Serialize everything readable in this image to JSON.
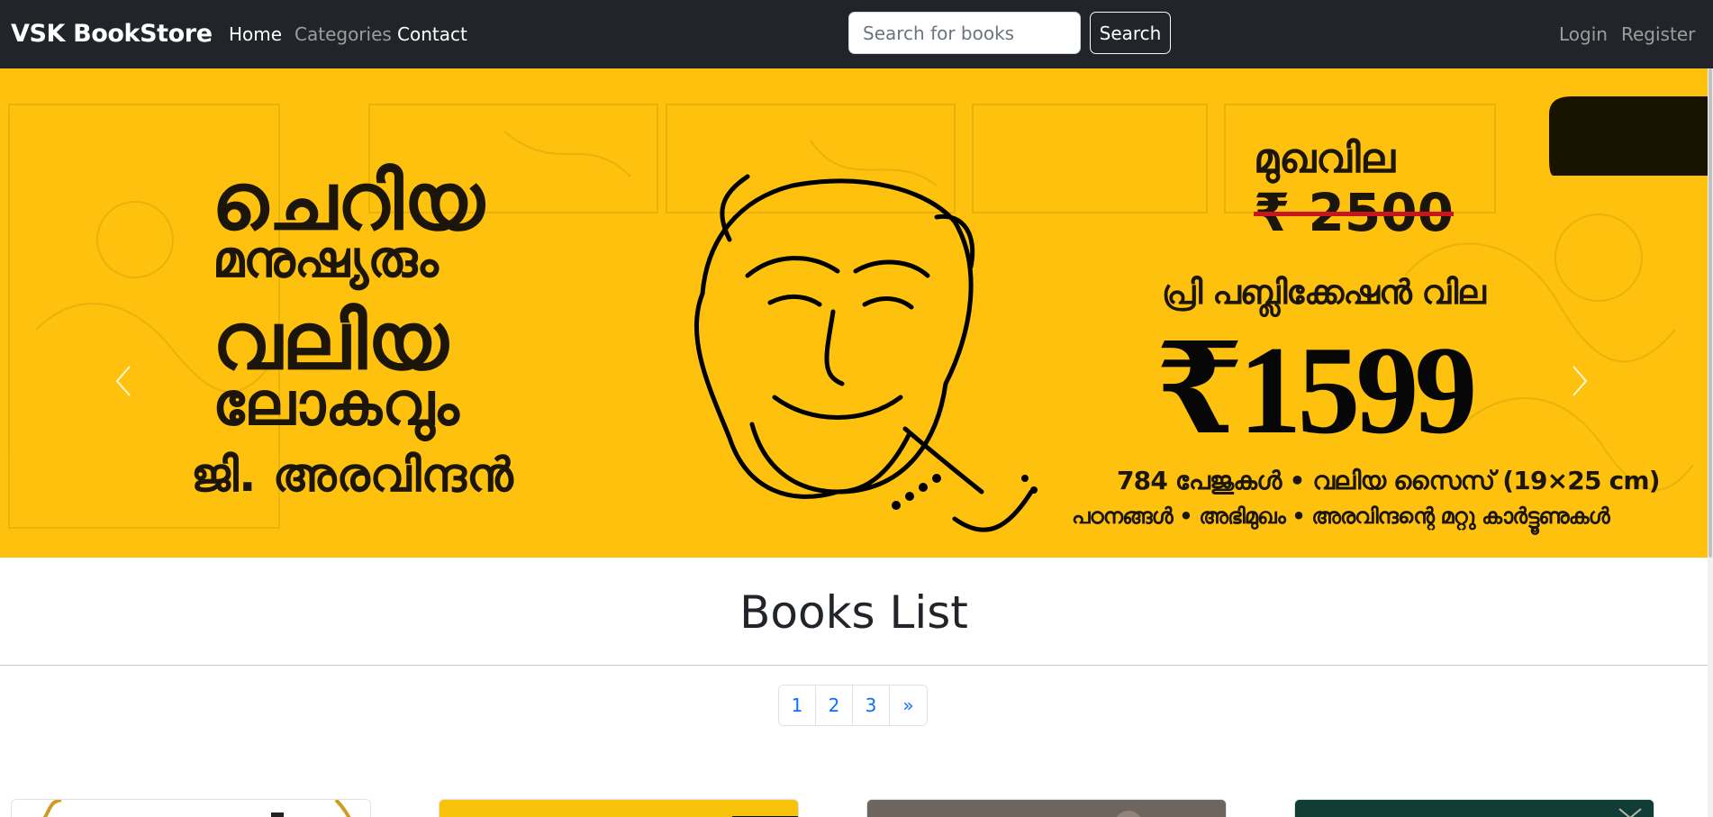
{
  "navbar": {
    "brand": "VSK BookStore",
    "links": [
      "Home",
      "Categories",
      "Contact"
    ],
    "search_placeholder": "Search for books",
    "search_button": "Search",
    "auth": [
      "Login",
      "Register"
    ]
  },
  "hero": {
    "title_line1": "ചെറിയ",
    "title_line2": "മനുഷ്യരും",
    "title_line3": "വലിയ",
    "title_line4": "ലോകവും",
    "author": "ജി. അരവിന്ദൻ",
    "face_price_label": "മുഖവില",
    "face_price": "₹ 2500",
    "prepub_label": "പ്രി പബ്ലിക്കേഷൻ വില",
    "prepub_price": "₹1599",
    "details_line1": "784 പേജുകൾ • വലിയ സൈസ് (19×25 cm)",
    "details_line2": "പഠനങ്ങൾ • അഭിമുഖം • അരവിന്ദന്റെ മറ്റു കാർട്ടൂണുകൾ"
  },
  "main": {
    "title": "Books List",
    "pages": [
      "1",
      "2",
      "3",
      "»"
    ]
  },
  "colors": {
    "navbar": "#212529",
    "hero": "#FDC10E",
    "link": "#0d6efd"
  }
}
